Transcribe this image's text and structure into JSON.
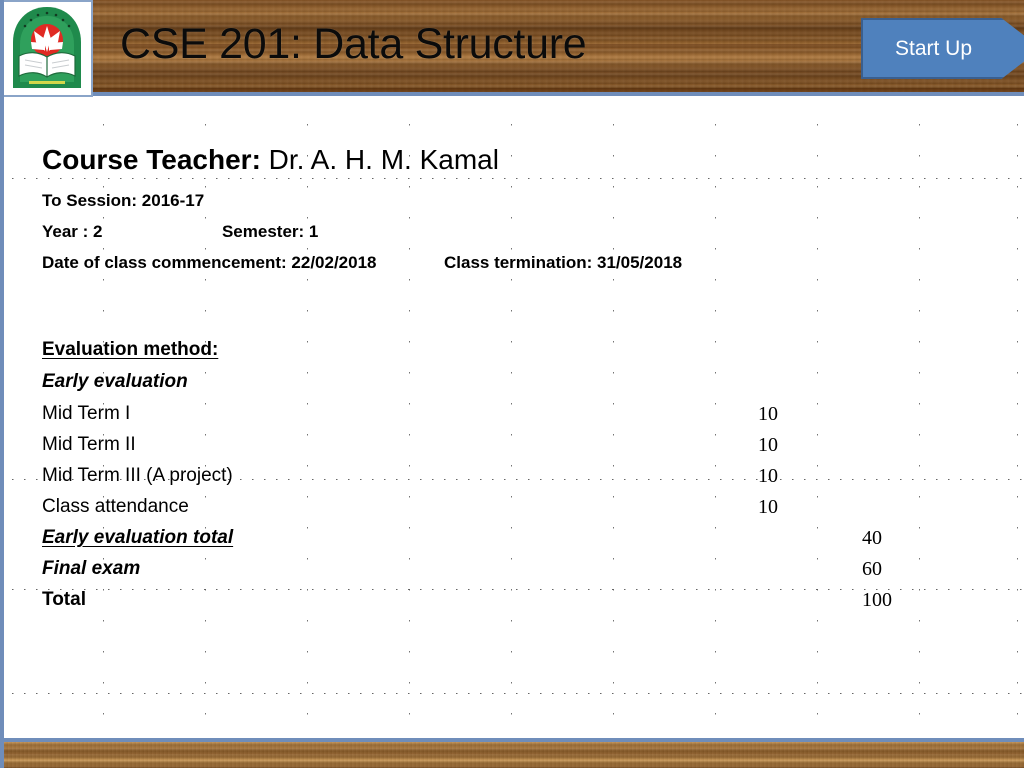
{
  "slide": {
    "title": "CSE 201: Data Structure",
    "startup_button_label": "Start Up",
    "logo_alt": "university-crest-logo"
  },
  "course": {
    "teacher_label": "Course Teacher:",
    "teacher_name": "Dr. A. H. M. Kamal",
    "session_line": "To Session: 2016-17",
    "year_label": "Year : 2",
    "semester_label": "Semester:  1",
    "commencement_label": "Date of class commencement: 22/02/2018",
    "termination_label": "Class termination: 31/05/2018"
  },
  "evaluation": {
    "heading": "Evaluation method:",
    "subheading": "Early evaluation",
    "rows": [
      {
        "name": "Mid Term I",
        "mark": "10",
        "column": "a",
        "style": "plain"
      },
      {
        "name": "Mid Term II",
        "mark": "10",
        "column": "a",
        "style": "plain"
      },
      {
        "name": "Mid Term III (A project)",
        "mark": "10",
        "column": "a",
        "style": "plain"
      },
      {
        "name": "Class attendance",
        "mark": "10",
        "column": "a",
        "style": "plain"
      },
      {
        "name": "Early evaluation total",
        "mark": "40",
        "column": "b",
        "style": "biu"
      },
      {
        "name": "Final exam",
        "mark": "60",
        "column": "b",
        "style": "bi"
      },
      {
        "name": "Total",
        "mark": "100",
        "column": "b",
        "style": "b"
      }
    ]
  },
  "theme": {
    "accent_blue": "#4f81bd",
    "border_blue": "#6f8dba",
    "wood_brown": "#9c6b34",
    "text_black": "#000000"
  }
}
